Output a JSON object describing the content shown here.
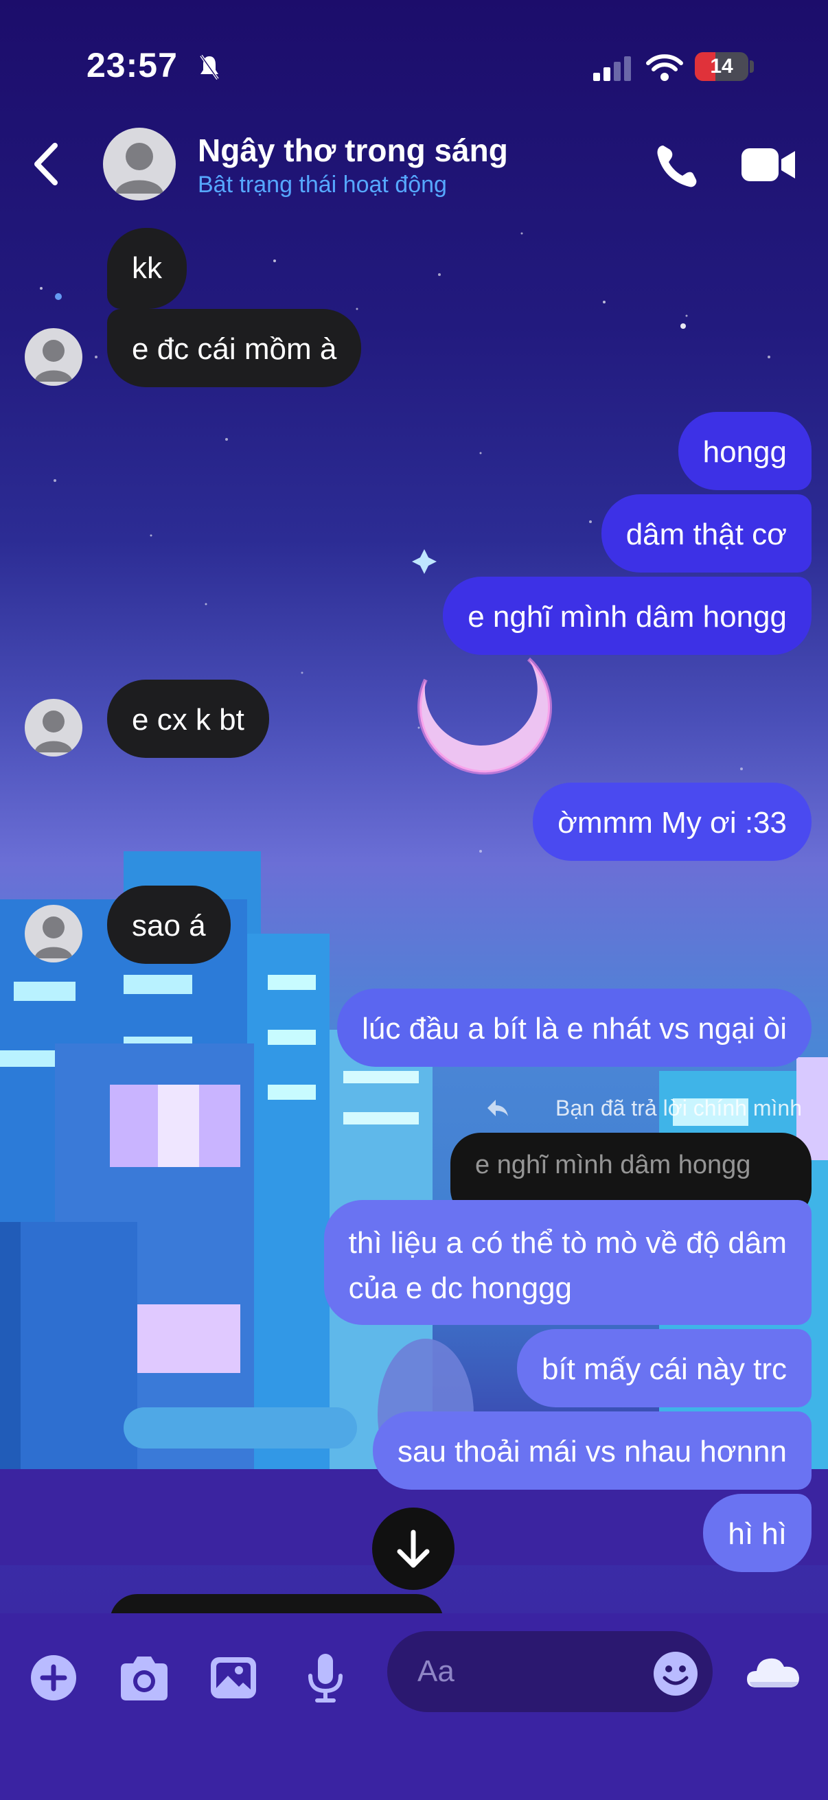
{
  "status_bar": {
    "time": "23:57",
    "battery": "14"
  },
  "header": {
    "contact_name": "Ngây thơ trong sáng",
    "contact_status": "Bật trạng thái hoạt động"
  },
  "messages": [
    {
      "text": "kk",
      "direction": "incoming"
    },
    {
      "text": "e đc cái mồm à",
      "direction": "incoming"
    },
    {
      "text": "hongg",
      "direction": "outgoing"
    },
    {
      "text": "dâm thật cơ",
      "direction": "outgoing"
    },
    {
      "text": "e nghĩ mình dâm hongg",
      "direction": "outgoing"
    },
    {
      "text": "e cx k bt",
      "direction": "incoming"
    },
    {
      "text": "ờmmm My ơi :33",
      "direction": "outgoing"
    },
    {
      "text": "sao á",
      "direction": "incoming"
    },
    {
      "text": "lúc đầu a bít là e nhát vs ngại òi",
      "direction": "outgoing"
    },
    {
      "text": "thì liệu a có thể tò mò về độ dâm",
      "text_line2": "của e dc honggg",
      "direction": "outgoing"
    },
    {
      "text": "bít mấy cái này trc",
      "direction": "outgoing"
    },
    {
      "text": "sau thoải mái vs nhau hơnnn",
      "direction": "outgoing"
    },
    {
      "text": "hì hì",
      "direction": "outgoing"
    }
  ],
  "reply": {
    "note": "Bạn đã trả lời chính mình",
    "quoted_text": "e nghĩ mình dâm hongg"
  },
  "composer": {
    "placeholder": "Aa",
    "icons": [
      "plus-icon",
      "camera-icon",
      "image-icon",
      "microphone-icon",
      "emoji-icon",
      "cloud-icon"
    ]
  },
  "colors": {
    "incoming_bubble": "#1d1d1f",
    "outgoing_bubble": "#4a4af0",
    "status_link": "#56a8ff",
    "battery_low": "#e0323a"
  }
}
